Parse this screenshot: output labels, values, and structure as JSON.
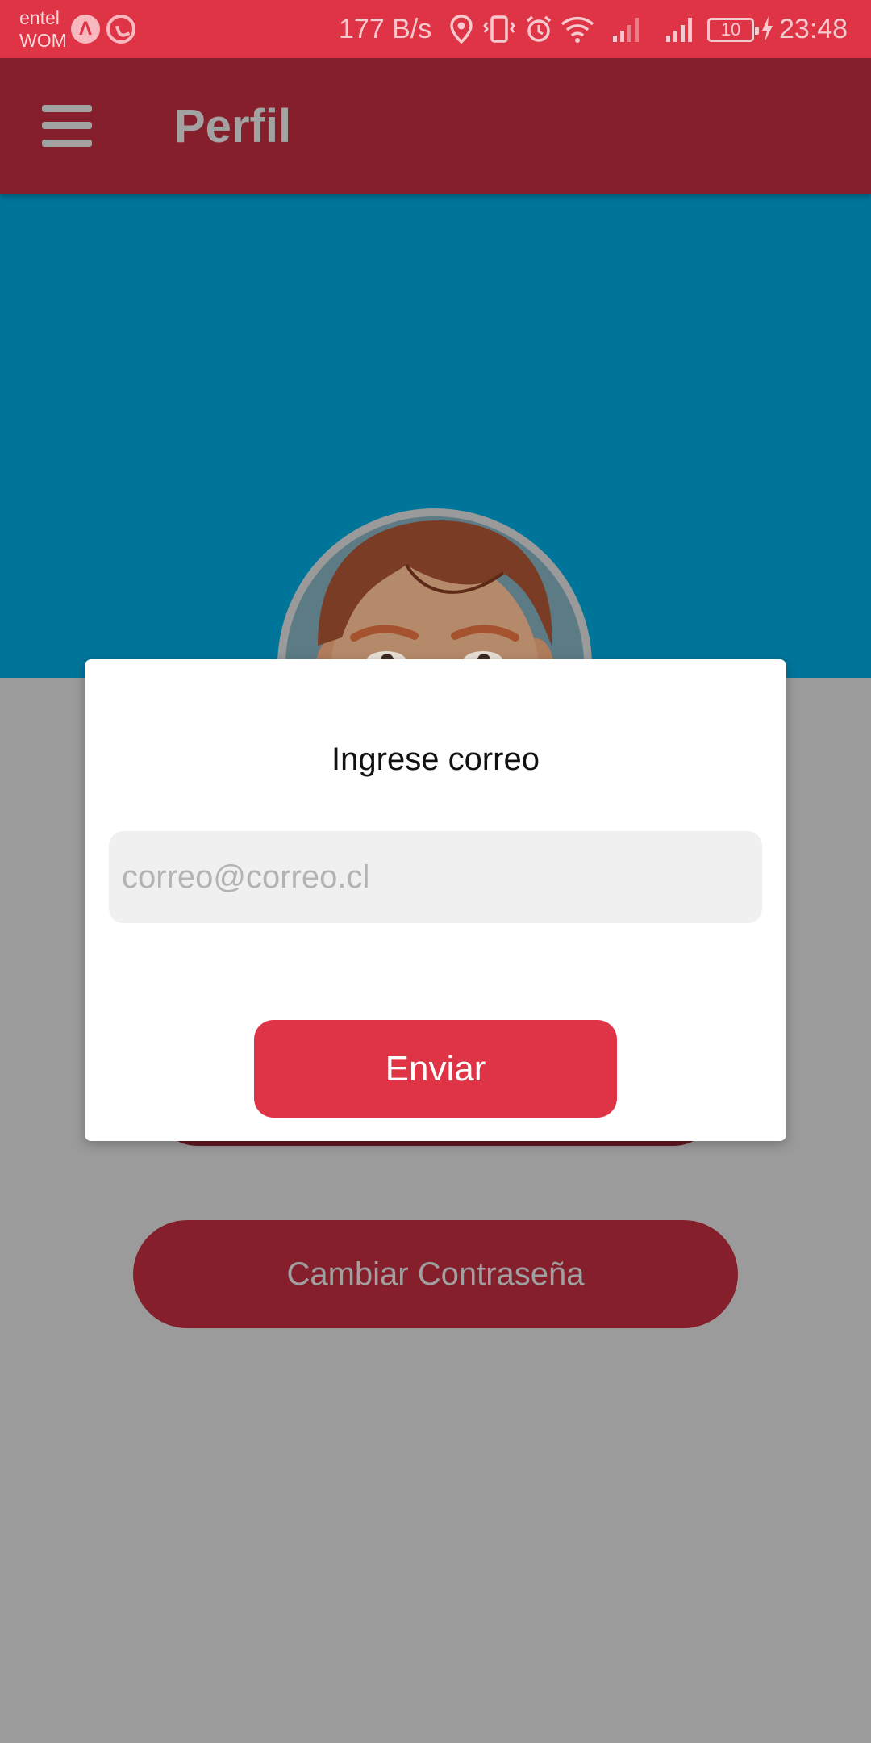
{
  "status_bar": {
    "carrier_1": "entel",
    "carrier_2": "WOM",
    "notification_icons": [
      "app-a-icon",
      "whatsapp-icon"
    ],
    "network_speed": "177 B/s",
    "system_icons": [
      "location-icon",
      "vibrate-icon",
      "alarm-icon",
      "wifi-icon",
      "signal-icon",
      "signal-icon",
      "charging-icon"
    ],
    "battery_level": "10",
    "time": "23:48"
  },
  "app_bar": {
    "title": "Perfil",
    "menu_icon": "hamburger-menu-icon"
  },
  "profile": {
    "avatar_icon": "cartoon-man-avatar",
    "change_password_label": "Cambiar Contraseña"
  },
  "dialog": {
    "title": "Ingrese correo",
    "email_value": "",
    "email_placeholder": "correo@correo.cl",
    "send_label": "Enviar"
  },
  "colors": {
    "status_bar": "#de3445",
    "app_bar": "#851f2b",
    "header": "#00759a",
    "scrim_background": "#9b9b9b",
    "accent_button": "#de3445",
    "dialog": "#ffffff"
  }
}
